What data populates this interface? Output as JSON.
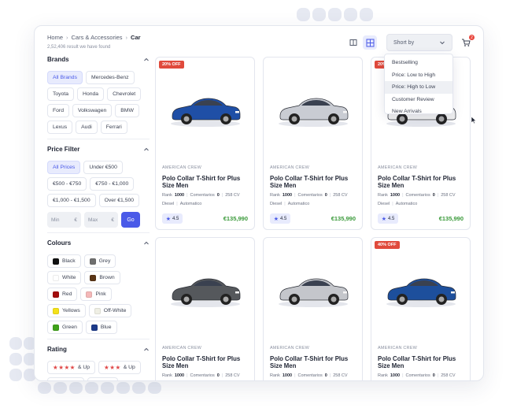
{
  "breadcrumb": {
    "items": [
      "Home",
      "Cars & Accessories",
      "Car"
    ],
    "separator": "›"
  },
  "result_count": "2,52,406 result we have found",
  "sort": {
    "label": "Short by",
    "options": [
      "Bestselling",
      "Price: Low to High",
      "Price: High to Low",
      "Customer Review",
      "New Arrivals"
    ],
    "highlighted": "Price: High to Low"
  },
  "cart": {
    "badge": "2"
  },
  "filters": {
    "brands": {
      "title": "Brands",
      "items": [
        "All Brands",
        "Mercedes-Benz",
        "Toyota",
        "Honda",
        "Chevrolet",
        "Ford",
        "Volkswagen",
        "BMW",
        "Lexus",
        "Audi",
        "Ferrari"
      ],
      "selected": "All Brands"
    },
    "price": {
      "title": "Price Filter",
      "items": [
        "All Prices",
        "Under €500",
        "€500 - €750",
        "€750 - €1,000",
        "€1,000 - €1,500",
        "Over €1,500"
      ],
      "selected": "All Prices",
      "min_placeholder": "Min",
      "max_placeholder": "Max",
      "currency": "€",
      "go_label": "Go"
    },
    "colours": {
      "title": "Colours",
      "items": [
        {
          "name": "Black",
          "color": "#111111"
        },
        {
          "name": "Grey",
          "color": "#6f6f6f"
        },
        {
          "name": "White",
          "color": "#ffffff"
        },
        {
          "name": "Brown",
          "color": "#5a3516"
        },
        {
          "name": "Red",
          "color": "#a30e0e"
        },
        {
          "name": "Pink",
          "color": "#f4b8b8"
        },
        {
          "name": "Yellows",
          "color": "#f4e11a"
        },
        {
          "name": "Off-White",
          "color": "#efefe4"
        },
        {
          "name": "Green",
          "color": "#3fa21a"
        },
        {
          "name": "Blue",
          "color": "#1c3a8a"
        }
      ]
    },
    "rating": {
      "title": "Rating",
      "items": [
        {
          "stars": "★★★★",
          "label": "& Up"
        },
        {
          "stars": "★★★",
          "label": "& Up"
        },
        {
          "stars": "★★",
          "label": "& Up"
        },
        {
          "stars": "★",
          "label": "& Up"
        }
      ]
    }
  },
  "products": [
    {
      "discount": "20% OFF",
      "brand": "AMERICAN CREW",
      "name": "Polo Collar T-Shirt for Plus Size Men",
      "rank_label": "Rank",
      "rank": "1000",
      "comments_label": "Comentarios",
      "comments": "0",
      "power": "258 CV",
      "fuel": "Diesel",
      "transmission": "Automatico",
      "rating": "4.5",
      "price": "€135,990",
      "car_color": "#1f4fa6"
    },
    {
      "discount": "",
      "brand": "AMERICAN CREW",
      "name": "Polo Collar T-Shirt for Plus Size Men",
      "rank_label": "Rank",
      "rank": "1000",
      "comments_label": "Comentarios",
      "comments": "0",
      "power": "258 CV",
      "fuel": "Diesel",
      "transmission": "Automatico",
      "rating": "4.5",
      "price": "€135,990",
      "car_color": "#c9ccd3"
    },
    {
      "discount": "20% OFF",
      "brand": "AMERICAN CREW",
      "name": "Polo Collar T-Shirt for Plus Size Men",
      "rank_label": "Rank",
      "rank": "1000",
      "comments_label": "Comentarios",
      "comments": "0",
      "power": "258 CV",
      "fuel": "Diesel",
      "transmission": "Automatico",
      "rating": "4.5",
      "price": "€135,990",
      "car_color": "#f2f2f2"
    },
    {
      "discount": "",
      "brand": "AMERICAN CREW",
      "name": "Polo Collar T-Shirt for Plus Size Men",
      "rank_label": "Rank",
      "rank": "1000",
      "comments_label": "Comentarios",
      "comments": "0",
      "power": "258 CV",
      "car_color": "#55585c"
    },
    {
      "discount": "",
      "brand": "AMERICAN CREW",
      "name": "Polo Collar T-Shirt for Plus Size Men",
      "rank_label": "Rank",
      "rank": "1000",
      "comments_label": "Comentarios",
      "comments": "0",
      "power": "258 CV",
      "car_color": "#c4c6cb"
    },
    {
      "discount": "40% OFF",
      "brand": "AMERICAN CREW",
      "name": "Polo Collar T-Shirt for Plus Size Men",
      "rank_label": "Rank",
      "rank": "1000",
      "comments_label": "Comentarios",
      "comments": "0",
      "power": "258 CV",
      "car_color": "#1d4f9c"
    }
  ],
  "colors": {
    "accent": "#4a5ae8",
    "discount": "#e04a3c",
    "price": "#3a9a3a",
    "star": "#e04a4a"
  }
}
